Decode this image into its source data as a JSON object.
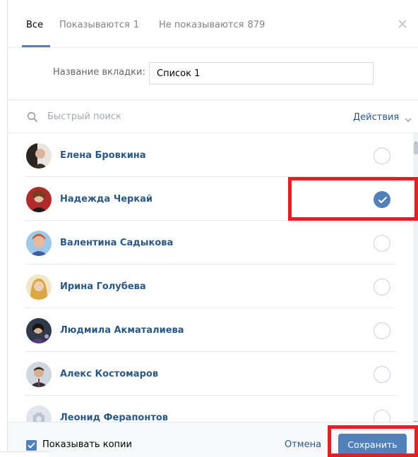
{
  "tabs": [
    {
      "label": "Все",
      "count": ""
    },
    {
      "label": "Показываются",
      "count": "1"
    },
    {
      "label": "Не показываются",
      "count": "879"
    }
  ],
  "form": {
    "name_label": "Название вкладки:",
    "name_value": "Список 1"
  },
  "search": {
    "placeholder": "Быстрый поиск",
    "actions_label": "Действия"
  },
  "users": [
    {
      "name": "Елена Бровкина",
      "checked": false
    },
    {
      "name": "Надежда Черкай",
      "checked": true
    },
    {
      "name": "Валентина Садыкова",
      "checked": false
    },
    {
      "name": "Ирина Голубева",
      "checked": false
    },
    {
      "name": "Людмила Акматалиева",
      "checked": false
    },
    {
      "name": "Алекс Костомаров",
      "checked": false
    },
    {
      "name": "Леонид Ферапонтов",
      "checked": false
    }
  ],
  "footer": {
    "show_copies_label": "Показывать копии",
    "show_copies_checked": true,
    "cancel_label": "Отмена",
    "save_label": "Сохранить"
  },
  "colors": {
    "accent": "#5181b8",
    "link": "#2a5885",
    "highlight": "#e31e24"
  }
}
